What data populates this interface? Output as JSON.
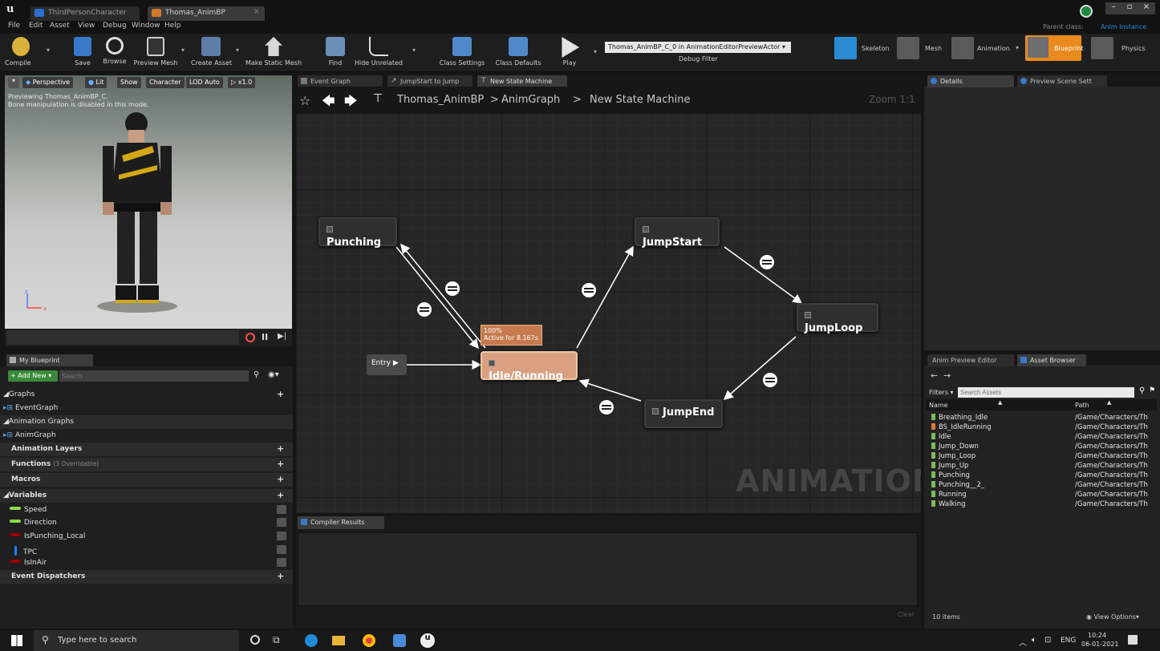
{
  "window": {
    "tabs": [
      {
        "label": "ThirdPersonCharacter"
      },
      {
        "label": "Thomas_AnimBP"
      }
    ],
    "menu": [
      "File",
      "Edit",
      "Asset",
      "View",
      "Debug",
      "Window",
      "Help"
    ],
    "parent_class_label": "Parent class:",
    "parent_class_value": "Anim Instance"
  },
  "toolbar": {
    "compile": "Compile",
    "save": "Save",
    "browse": "Browse",
    "preview_mesh": "Preview Mesh",
    "create_asset": "Create Asset",
    "make_static_mesh": "Make Static Mesh",
    "find": "Find",
    "hide_unrelated": "Hide Unrelated",
    "class_settings": "Class Settings",
    "class_defaults": "Class Defaults",
    "play": "Play",
    "debug_select": "Thomas_AnimBP_C_0 in AnimationEditorPreviewActor",
    "debug_filter": "Debug Filter",
    "modes": [
      "Skeleton",
      "Mesh",
      "Animation",
      "Blueprint",
      "Physics"
    ]
  },
  "viewport": {
    "perspective": "Perspective",
    "lit": "Lit",
    "show": "Show",
    "character": "Character",
    "lod": "LOD Auto",
    "speed": "x1.0",
    "info_line1": "Previewing Thomas_AnimBP_C.",
    "info_line2": "Bone manipulation is disabled in this mode."
  },
  "graph_tabs": [
    "Event Graph",
    "JumpStart to Jump",
    "New State Machine"
  ],
  "breadcrumb": {
    "root": "Thomas_AnimBP",
    "sep1": ">",
    "mid": "AnimGraph",
    "sep2": ">",
    "leaf": "New State Machine"
  },
  "zoom": "Zoom 1:1",
  "watermark": "ANIMATION",
  "states": {
    "punching": "Punching",
    "jumpstart": "JumpStart",
    "jumploop": "JumpLoop",
    "jumpend": "JumpEnd",
    "idle": "Idle/Running",
    "entry": "Entry",
    "tooltip_pct": "100%",
    "tooltip_active": "Active for 8.167s"
  },
  "my_blueprint": {
    "title": "My Blueprint",
    "add_new": "+ Add New",
    "search_placeholder": "Search",
    "graphs": "Graphs",
    "event_graph": "EventGraph",
    "animation_graphs": "Animation Graphs",
    "anim_graph": "AnimGraph",
    "animation_layers": "Animation Layers",
    "functions": "Functions",
    "functions_note": "(3 Overridable)",
    "macros": "Macros",
    "variables": "Variables",
    "vars": [
      {
        "name": "Speed",
        "color": "#8bdb45"
      },
      {
        "name": "Direction",
        "color": "#8bdb45"
      },
      {
        "name": "IsPunching_Local",
        "color": "#930000"
      },
      {
        "name": "TPC",
        "color": "#1a7fff"
      },
      {
        "name": "IsInAir",
        "color": "#930000"
      }
    ],
    "event_dispatchers": "Event Dispatchers"
  },
  "compiler": {
    "title": "Compiler Results",
    "clear": "Clear"
  },
  "details": {
    "tab1": "Details",
    "tab2": "Preview Scene Sett"
  },
  "asset_browser": {
    "tab1": "Anim Preview Editor",
    "tab2": "Asset Browser",
    "filters": "Filters",
    "search_placeholder": "Search Assets",
    "col_name": "Name",
    "col_path": "Path",
    "items": [
      {
        "name": "Breathing_Idle",
        "path": "/Game/Characters/Th",
        "color": "#7aba5a"
      },
      {
        "name": "BS_IdleRunning",
        "path": "/Game/Characters/Th",
        "color": "#e07a3a"
      },
      {
        "name": "Idle",
        "path": "/Game/Characters/Th",
        "color": "#7aba5a"
      },
      {
        "name": "Jump_Down",
        "path": "/Game/Characters/Th",
        "color": "#7aba5a"
      },
      {
        "name": "Jump_Loop",
        "path": "/Game/Characters/Th",
        "color": "#7aba5a"
      },
      {
        "name": "Jump_Up",
        "path": "/Game/Characters/Th",
        "color": "#7aba5a"
      },
      {
        "name": "Punching",
        "path": "/Game/Characters/Th",
        "color": "#7aba5a"
      },
      {
        "name": "Punching__2_",
        "path": "/Game/Characters/Th",
        "color": "#7aba5a"
      },
      {
        "name": "Running",
        "path": "/Game/Characters/Th",
        "color": "#7aba5a"
      },
      {
        "name": "Walking",
        "path": "/Game/Characters/Th",
        "color": "#7aba5a"
      }
    ],
    "count": "10 items",
    "view_options": "View Options"
  },
  "taskbar": {
    "search": "Type here to search",
    "lang": "ENG",
    "time": "10:24",
    "date": "06-01-2021"
  }
}
